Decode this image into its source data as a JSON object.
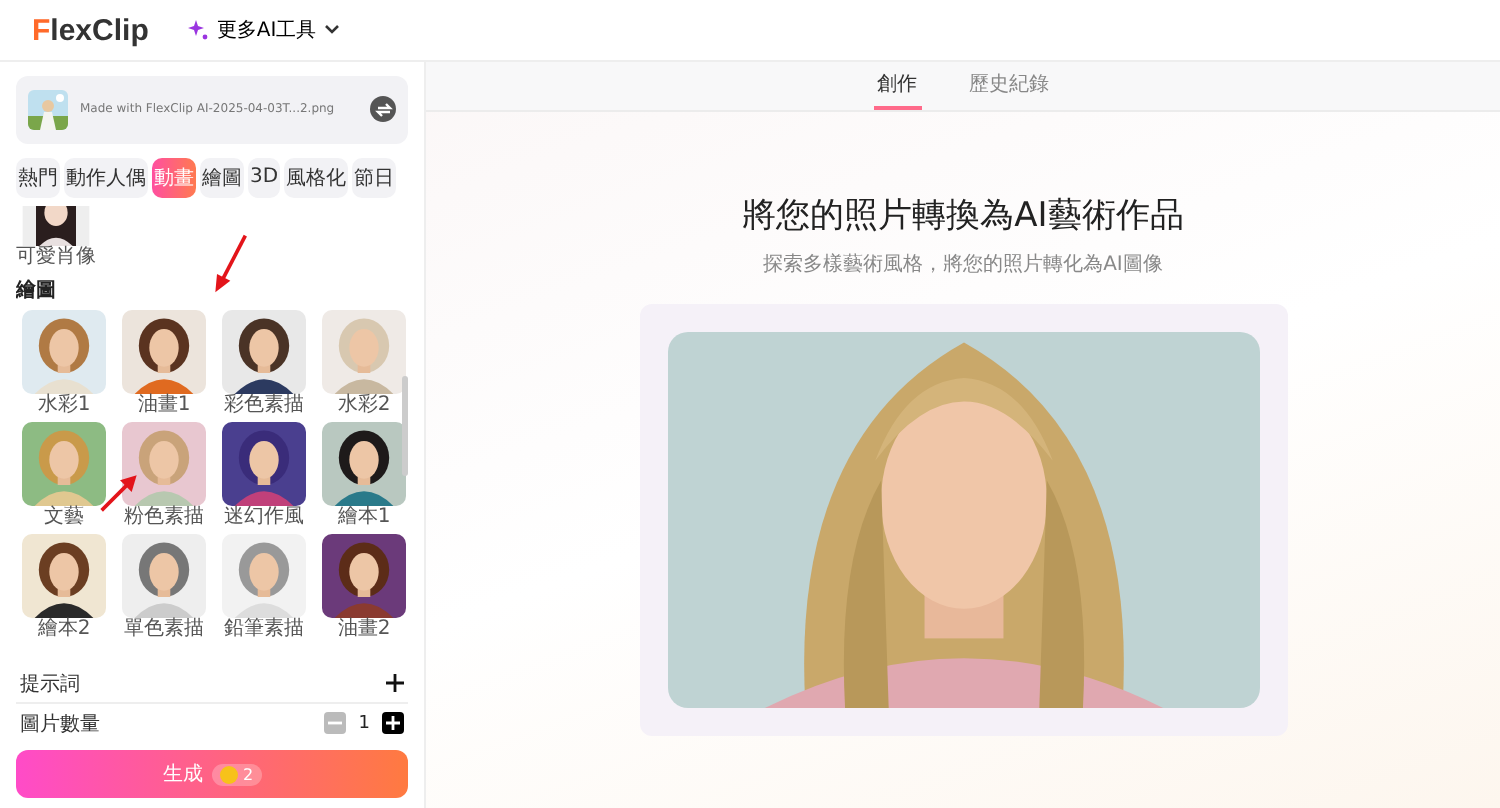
{
  "header": {
    "logo": "FlexClip",
    "menu": "更多AI工具"
  },
  "sidebar": {
    "file": {
      "name": "Made with FlexClip AI-2025-04-03T...2.png"
    },
    "categories": [
      {
        "label": "熱門",
        "selected": false
      },
      {
        "label": "動作人偶",
        "selected": false
      },
      {
        "label": "動畫",
        "selected": true
      },
      {
        "label": "繪圖",
        "selected": false
      },
      {
        "label": "3D",
        "selected": false
      },
      {
        "label": "風格化",
        "selected": false
      },
      {
        "label": "節日",
        "selected": false
      }
    ],
    "partial_style": {
      "label": "可愛肖像"
    },
    "section": "繪圖",
    "styles": [
      {
        "label": "水彩1"
      },
      {
        "label": "油畫1"
      },
      {
        "label": "彩色素描"
      },
      {
        "label": "水彩2"
      },
      {
        "label": "文藝"
      },
      {
        "label": "粉色素描"
      },
      {
        "label": "迷幻作風"
      },
      {
        "label": "繪本1"
      },
      {
        "label": "繪本2"
      },
      {
        "label": "單色素描"
      },
      {
        "label": "鉛筆素描"
      },
      {
        "label": "油畫2"
      }
    ],
    "prompt": {
      "label": "提示詞"
    },
    "count": {
      "label": "圖片數量",
      "value": "1",
      "minus_disabled": true
    },
    "generate": {
      "label": "生成",
      "cost": "2"
    }
  },
  "main": {
    "tabs": [
      {
        "label": "創作",
        "selected": true
      },
      {
        "label": "歷史紀錄",
        "selected": false
      }
    ],
    "title": "將您的照片轉換為AI藝術作品",
    "subtitle": "探索多樣藝術風格，將您的照片轉化為AI圖像"
  }
}
